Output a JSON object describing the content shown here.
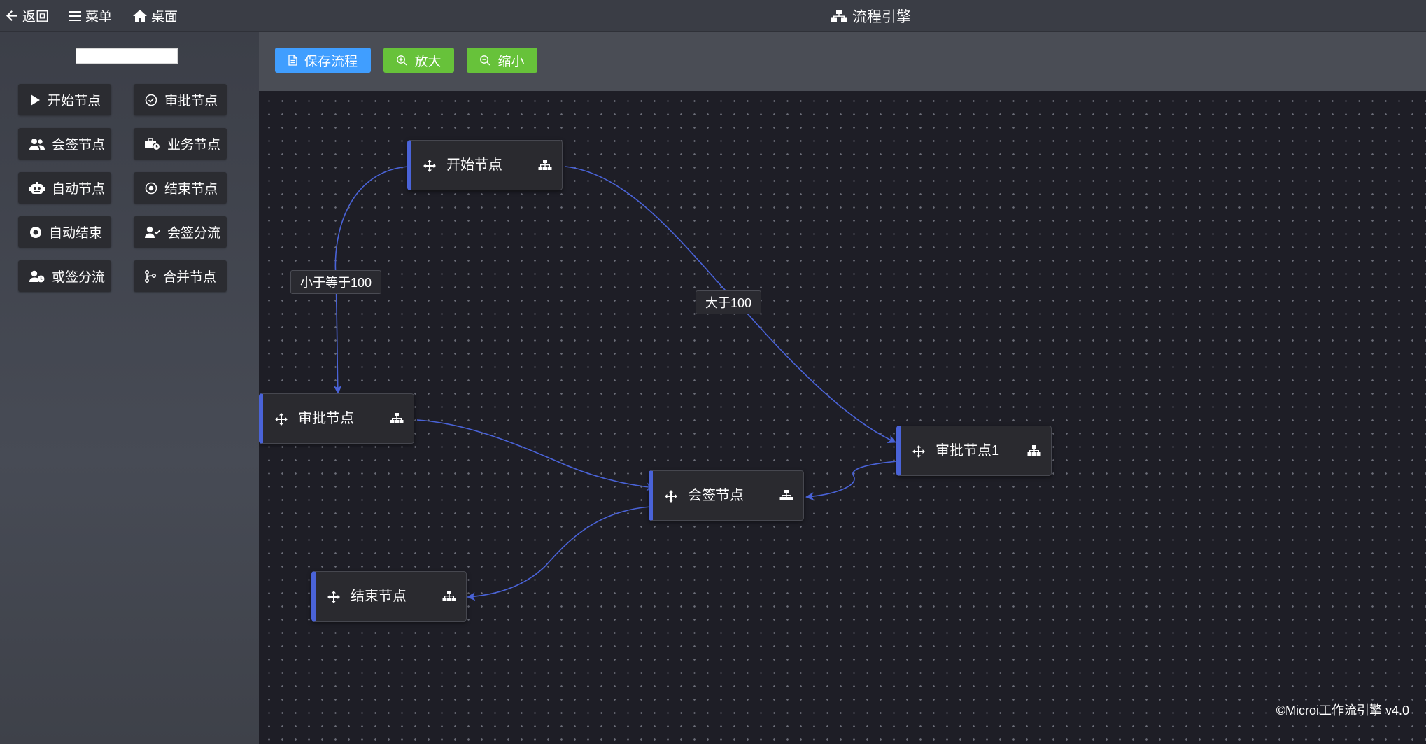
{
  "topbar": {
    "back_label": "返回",
    "menu_label": "菜单",
    "desktop_label": "桌面",
    "title": "流程引擎"
  },
  "sidebar": {
    "search": {
      "value": "",
      "placeholder": ""
    },
    "items": [
      {
        "label": "开始节点",
        "icon": "play-icon"
      },
      {
        "label": "审批节点",
        "icon": "check-circle-icon"
      },
      {
        "label": "会签节点",
        "icon": "users-icon"
      },
      {
        "label": "业务节点",
        "icon": "briefcase-clock-icon"
      },
      {
        "label": "自动节点",
        "icon": "robot-icon"
      },
      {
        "label": "结束节点",
        "icon": "dot-circle-icon"
      },
      {
        "label": "自动结束",
        "icon": "record-icon"
      },
      {
        "label": "会签分流",
        "icon": "user-check-icon"
      },
      {
        "label": "或签分流",
        "icon": "user-clock-icon"
      },
      {
        "label": "合并节点",
        "icon": "code-branch-icon"
      }
    ]
  },
  "toolbar": {
    "save_label": "保存流程",
    "zoom_in_label": "放大",
    "zoom_out_label": "缩小"
  },
  "flow": {
    "nodes": [
      {
        "id": "start",
        "label": "开始节点"
      },
      {
        "id": "approve",
        "label": "审批节点"
      },
      {
        "id": "approve1",
        "label": "审批节点1"
      },
      {
        "id": "countersign",
        "label": "会签节点"
      },
      {
        "id": "end",
        "label": "结束节点"
      }
    ],
    "edges": [
      {
        "from": "start",
        "to": "approve",
        "label": "小于等于100"
      },
      {
        "from": "start",
        "to": "approve1",
        "label": "大于100"
      },
      {
        "from": "approve",
        "to": "countersign",
        "label": ""
      },
      {
        "from": "approve1",
        "to": "countersign",
        "label": ""
      },
      {
        "from": "countersign",
        "to": "end",
        "label": ""
      }
    ]
  },
  "footer": {
    "copyright": "©Microi工作流引擎 v4.0"
  },
  "colors": {
    "accent": "#4a63d8",
    "save_button": "#409eff",
    "zoom_button": "#67c23a",
    "canvas_bg": "#1e1e26"
  }
}
